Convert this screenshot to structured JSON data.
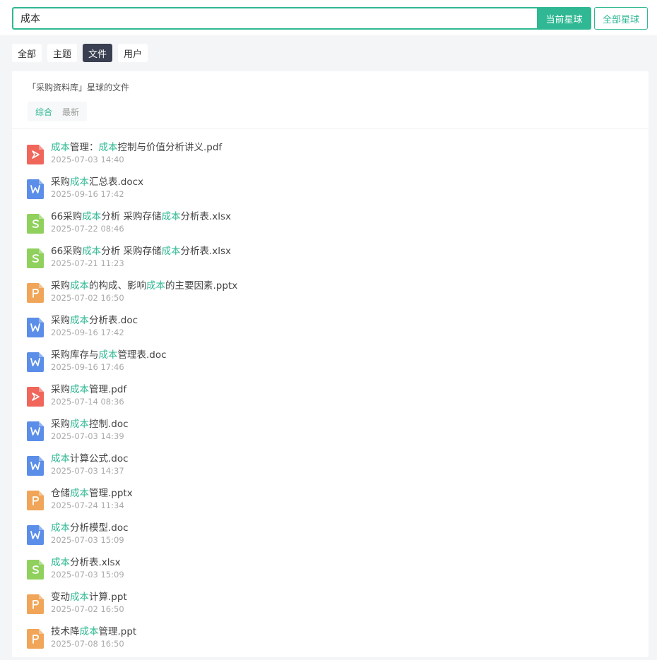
{
  "search": {
    "value": "成本",
    "current_planet_label": "当前星球",
    "all_planets_label": "全部星球"
  },
  "tabs": [
    {
      "label": "全部",
      "active": false
    },
    {
      "label": "主题",
      "active": false
    },
    {
      "label": "文件",
      "active": true
    },
    {
      "label": "用户",
      "active": false
    }
  ],
  "panel": {
    "title": "「采购资料库」星球的文件",
    "sort_options": [
      {
        "label": "综合",
        "active": true
      },
      {
        "label": "最新",
        "active": false
      }
    ]
  },
  "files": [
    {
      "type": "pdf",
      "name": "成本管理：成本控制与价值分析讲义.pdf",
      "date": "2025-07-03 14:40"
    },
    {
      "type": "word",
      "name": "采购成本汇总表.docx",
      "date": "2025-09-16 17:42"
    },
    {
      "type": "excel",
      "name": "66采购成本分析 采购存储成本分析表.xlsx",
      "date": "2025-07-22 08:46"
    },
    {
      "type": "excel",
      "name": "66采购成本分析 采购存储成本分析表.xlsx",
      "date": "2025-07-21 11:23"
    },
    {
      "type": "ppt",
      "name": "采购成本的构成、影响成本的主要因素.pptx",
      "date": "2025-07-02 16:50"
    },
    {
      "type": "word",
      "name": "采购成本分析表.doc",
      "date": "2025-09-16 17:42"
    },
    {
      "type": "word",
      "name": "采购库存与成本管理表.doc",
      "date": "2025-09-16 17:46"
    },
    {
      "type": "pdf",
      "name": "采购成本管理.pdf",
      "date": "2025-07-14 08:36"
    },
    {
      "type": "word",
      "name": "采购成本控制.doc",
      "date": "2025-07-03 14:39"
    },
    {
      "type": "word",
      "name": "成本计算公式.doc",
      "date": "2025-07-03 14:37"
    },
    {
      "type": "ppt",
      "name": "仓储成本管理.pptx",
      "date": "2025-07-24 11:34"
    },
    {
      "type": "word",
      "name": "成本分析模型.doc",
      "date": "2025-07-03 15:09"
    },
    {
      "type": "excel",
      "name": "成本分析表.xlsx",
      "date": "2025-07-03 15:09"
    },
    {
      "type": "ppt",
      "name": "变动成本计算.ppt",
      "date": "2025-07-02 16:50"
    },
    {
      "type": "ppt",
      "name": "技术降成本管理.ppt",
      "date": "2025-07-08 16:50"
    }
  ],
  "highlight_term": "成本",
  "colors": {
    "accent": "#2fb893",
    "pdf": "#f0665a",
    "word": "#5b8ee8",
    "excel": "#8fd15c",
    "ppt": "#f0a558",
    "active_tab": "#3a3f51"
  },
  "icons": {
    "pdf": "pdf-icon",
    "word": "word-doc-icon",
    "excel": "excel-sheet-icon",
    "ppt": "ppt-slide-icon"
  }
}
